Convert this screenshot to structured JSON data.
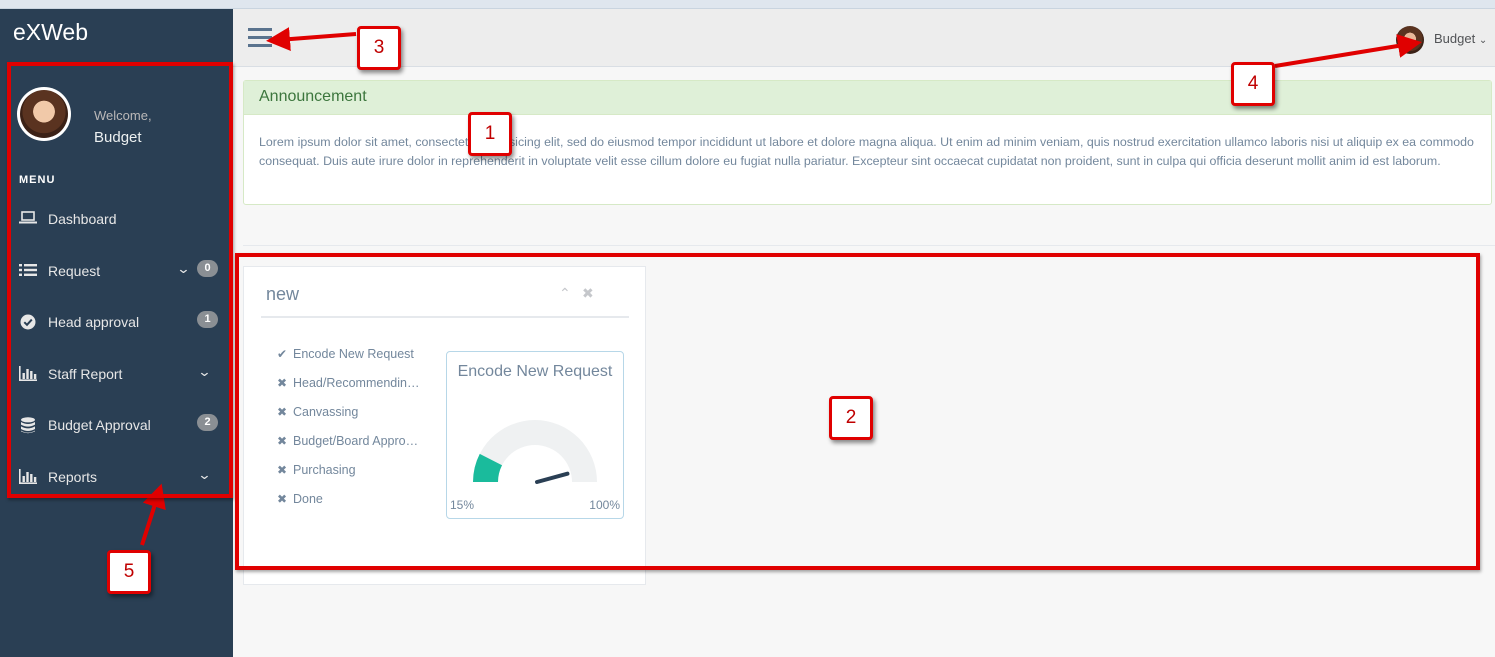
{
  "app": {
    "brand": "eXWeb"
  },
  "profile": {
    "welcome": "Welcome,",
    "name": "Budget"
  },
  "menu": {
    "title": "MENU",
    "items": [
      {
        "label": "Dashboard",
        "icon": "laptop-icon",
        "badge": "",
        "chevron": false
      },
      {
        "label": "Request",
        "icon": "list-icon",
        "badge": "0",
        "chevron": true
      },
      {
        "label": "Head approval",
        "icon": "check-circle-icon",
        "badge": "1",
        "chevron": false
      },
      {
        "label": "Staff Report",
        "icon": "bar-chart-icon",
        "badge": "",
        "chevron": true
      },
      {
        "label": "Budget Approval",
        "icon": "database-icon",
        "badge": "2",
        "chevron": false
      },
      {
        "label": "Reports",
        "icon": "bar-chart-icon",
        "badge": "",
        "chevron": true
      }
    ]
  },
  "topnav": {
    "user": "Budget"
  },
  "announcement": {
    "title": "Announcement",
    "body": "Lorem ipsum dolor sit amet, consectetur adipisicing elit, sed do eiusmod tempor incididunt ut labore et dolore magna aliqua. Ut enim ad minim veniam, quis nostrud exercitation ullamco laboris nisi ut aliquip ex ea commodo consequat. Duis aute irure dolor in reprehenderit in voluptate velit esse cillum dolore eu fugiat nulla pariatur. Excepteur sint occaecat cupidatat non proident, sunt in culpa qui officia deserunt mollit anim id est laborum."
  },
  "panel": {
    "title": "new",
    "steps": [
      {
        "label": "Encode New Request",
        "status": "done"
      },
      {
        "label": "Head/Recommendin…",
        "status": "pending"
      },
      {
        "label": "Canvassing",
        "status": "pending"
      },
      {
        "label": "Budget/Board Appro…",
        "status": "pending"
      },
      {
        "label": "Purchasing",
        "status": "pending"
      },
      {
        "label": "Done",
        "status": "pending"
      }
    ],
    "gauge": {
      "title": "Encode New Request",
      "min_label": "15%",
      "max_label": "100%",
      "value_percent": 15,
      "fill_color": "#1abb9c",
      "track_color": "#eff1f2"
    }
  },
  "annotations": [
    "1",
    "2",
    "3",
    "4",
    "5"
  ],
  "colors": {
    "sidebar": "#2a3f54",
    "annotation_red": "#e00000"
  }
}
